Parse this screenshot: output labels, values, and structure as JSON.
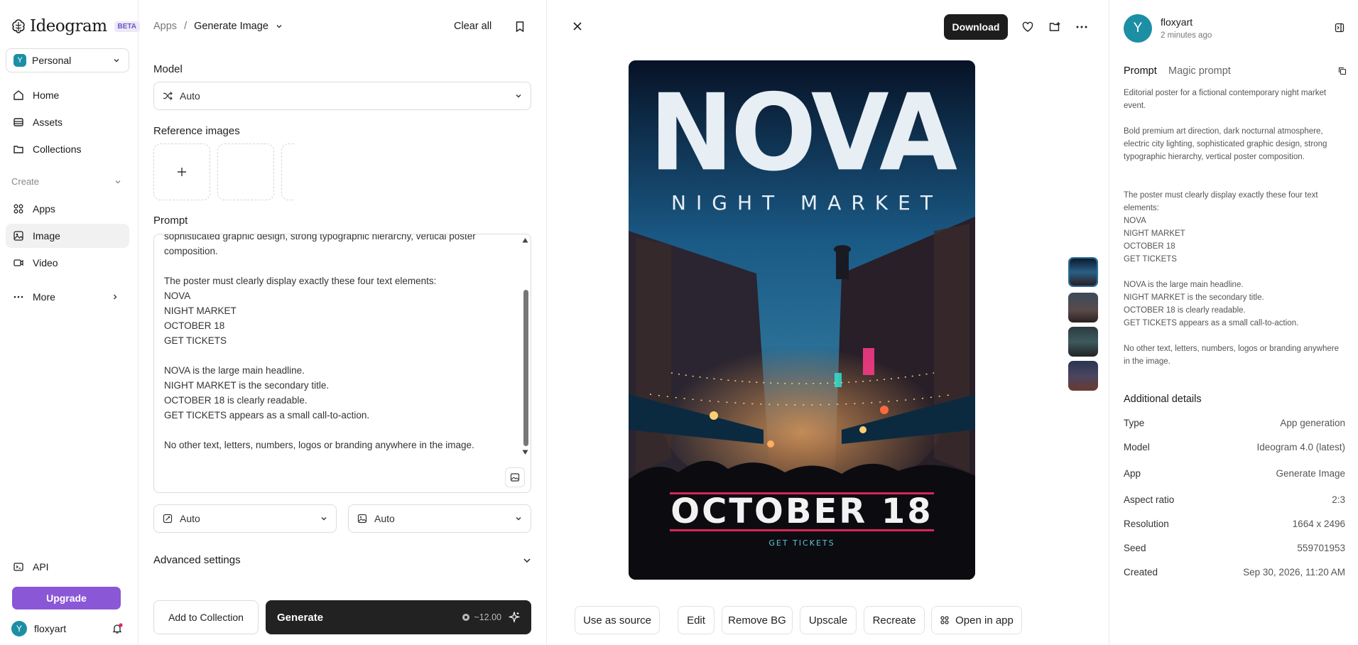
{
  "app": {
    "name": "Ideogram",
    "badge": "BETA"
  },
  "workspace": {
    "initial": "Y",
    "name": "Personal"
  },
  "nav": {
    "home": "Home",
    "assets": "Assets",
    "collections": "Collections",
    "create_section": "Create",
    "apps": "Apps",
    "image": "Image",
    "video": "Video",
    "more": "More",
    "api": "API",
    "upgrade": "Upgrade"
  },
  "user": {
    "initial": "Y",
    "name": "floxyart"
  },
  "header": {
    "breadcrumb_root": "Apps",
    "breadcrumb_sep": "/",
    "breadcrumb_current": "Generate Image",
    "clear_all": "Clear all"
  },
  "form": {
    "model_label": "Model",
    "model_value": "Auto",
    "reference_label": "Reference images",
    "prompt_label": "Prompt",
    "prompt_text": "sophisticated graphic design, strong typographic hierarchy, vertical poster\ncomposition.\n\nThe poster must clearly display exactly these four text elements:\nNOVA\nNIGHT MARKET\nOCTOBER 18\nGET TICKETS\n\nNOVA is the large main headline.\nNIGHT MARKET is the secondary title.\nOCTOBER 18 is clearly readable.\nGET TICKETS appears as a small call-to-action.\n\nNo other text, letters, numbers, logos or branding anywhere in the image.",
    "select_a": "Auto",
    "select_b": "Auto",
    "advanced": "Advanced settings",
    "add_to_collection": "Add to Collection",
    "generate": "Generate",
    "cost": "~12.00"
  },
  "viewer": {
    "download": "Download",
    "poster": {
      "headline": "NOVA",
      "subtitle": "NIGHT MARKET",
      "date": "OCTOBER 18",
      "cta": "GET TICKETS"
    },
    "actions": [
      "Use as source",
      "Edit",
      "Remove BG",
      "Upscale",
      "Recreate",
      "Open in app"
    ]
  },
  "details": {
    "author_initial": "Y",
    "author": "floxyart",
    "time": "2 minutes ago",
    "tab_prompt": "Prompt",
    "tab_magic": "Magic prompt",
    "prompt_paragraphs": [
      "Editorial poster for a fictional contemporary night market event.",
      "Bold premium art direction, dark nocturnal atmosphere, electric city lighting, sophisticated graphic design, strong typographic hierarchy, vertical poster composition.",
      "The poster must clearly display exactly these four text elements:\nNOVA\nNIGHT MARKET\nOCTOBER 18\nGET TICKETS",
      "NOVA is the large main headline.\nNIGHT MARKET is the secondary title.\nOCTOBER 18 is clearly readable.\nGET TICKETS appears as a small call-to-action.",
      "No other text, letters, numbers, logos or branding anywhere in the image."
    ],
    "additional_title": "Additional details",
    "rows": [
      {
        "k": "Type",
        "v": "App generation"
      },
      {
        "k": "Model",
        "v": "Ideogram 4.0 (latest)"
      },
      {
        "k": "App",
        "v": "Generate Image"
      },
      {
        "k": "Aspect ratio",
        "v": "2:3"
      },
      {
        "k": "Resolution",
        "v": "1664 x 2496"
      },
      {
        "k": "Seed",
        "v": "559701953"
      },
      {
        "k": "Created",
        "v": "Sep 30, 2026, 11:20 AM"
      }
    ]
  },
  "colors": {
    "accent": "#8a58d6",
    "avatar": "#1c8fa4",
    "dark": "#1d1d1d",
    "poster_red": "#d8265a"
  }
}
